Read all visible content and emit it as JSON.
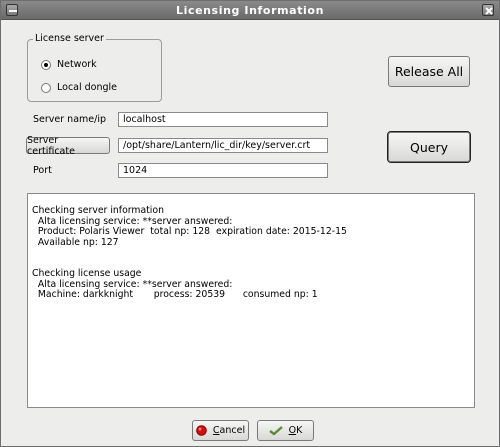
{
  "window": {
    "title": "Licensing Information"
  },
  "license_server": {
    "group_label": "License server",
    "options": [
      {
        "label": "Network",
        "selected": true
      },
      {
        "label": "Local dongle",
        "selected": false
      }
    ]
  },
  "fields": {
    "server_label": "Server name/ip",
    "server_value": "localhost",
    "cert_button": "Server certificate",
    "cert_value": "/opt/share/Lantern/lic_dir/key/server.crt",
    "port_label": "Port",
    "port_value": "1024"
  },
  "actions": {
    "release_all": "Release All",
    "query": "Query"
  },
  "output": {
    "block1": [
      "Checking server information",
      "  Alta licensing service: **server answered:",
      "  Product: Polaris Viewer  total np: 128  expiration date: 2015-12-15",
      "  Available np: 127"
    ],
    "block2": [
      "Checking license usage",
      "  Alta licensing service: **server answered:",
      "  Machine: darkknight       process: 20539      consumed np: 1"
    ]
  },
  "footer": {
    "cancel_accel": "C",
    "cancel_rest": "ancel",
    "ok_accel": "O",
    "ok_rest": "K"
  },
  "colors": {
    "titlebar": "#7a7a7a",
    "cancel_icon": "#d01010",
    "ok_icon": "#5a8a3a"
  }
}
